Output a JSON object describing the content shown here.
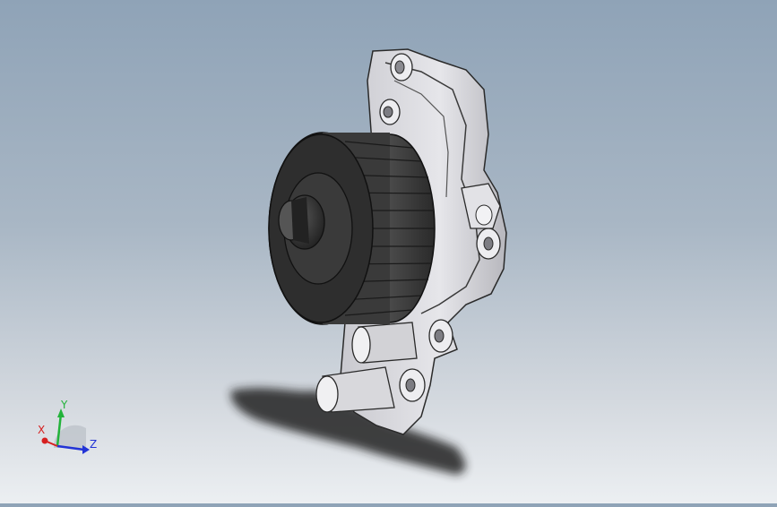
{
  "viewport": {
    "model": "water-pump-with-timing-gear",
    "background_top": "#8fa3b7",
    "background_bottom": "#eceff2"
  },
  "triad": {
    "x_label": "X",
    "y_label": "Y",
    "z_label": "Z",
    "x_color": "#d62020",
    "y_color": "#22b33a",
    "z_color": "#2233d6"
  }
}
